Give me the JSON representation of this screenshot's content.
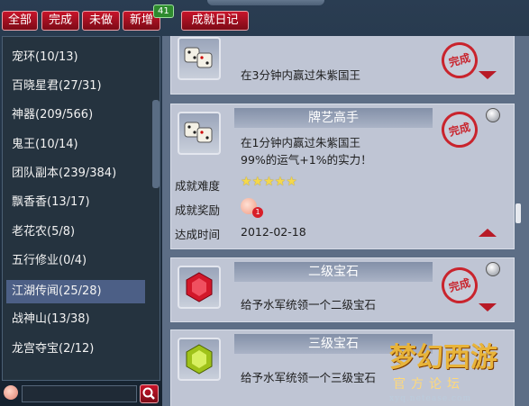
{
  "tabs": {
    "all": "全部",
    "done": "完成",
    "not_done": "未做",
    "new": "新增",
    "new_count": "41",
    "diary": "成就日记"
  },
  "categories": [
    {
      "label": "宠环(10/13)"
    },
    {
      "label": "百晓星君(27/31)"
    },
    {
      "label": "神器(209/566)"
    },
    {
      "label": "鬼王(10/14)"
    },
    {
      "label": "团队副本(239/384)"
    },
    {
      "label": "飘香香(13/17)"
    },
    {
      "label": "老花农(5/8)"
    },
    {
      "label": "五行修业(0/4)"
    },
    {
      "label": "江湖传闻(25/28)",
      "selected": true
    },
    {
      "label": "战神山(13/38)"
    },
    {
      "label": "龙宫夺宝(2/12)"
    }
  ],
  "search": {
    "value": ""
  },
  "cards": {
    "card0": {
      "desc": "在3分钟内赢过朱紫国王",
      "stamp": "完成"
    },
    "card1": {
      "title": "牌艺高手",
      "desc1": "在1分钟内赢过朱紫国王",
      "desc2": "99%的运气+1%的实力！",
      "stamp": "完成",
      "difficulty_label": "成就难度",
      "difficulty_stars": "★★★★★",
      "reward_label": "成就奖励",
      "reward_count": "1",
      "date_label": "达成时间",
      "date": "2012-02-18"
    },
    "card2": {
      "title": "二级宝石",
      "desc": "给予水军统领一个二级宝石",
      "stamp": "完成"
    },
    "card3": {
      "title": "三级宝石",
      "desc": "给予水军统领一个三级宝石"
    }
  },
  "logo": {
    "big": "梦幻西游",
    "sub": "官方论坛",
    "url": "xyq.netease.com"
  }
}
